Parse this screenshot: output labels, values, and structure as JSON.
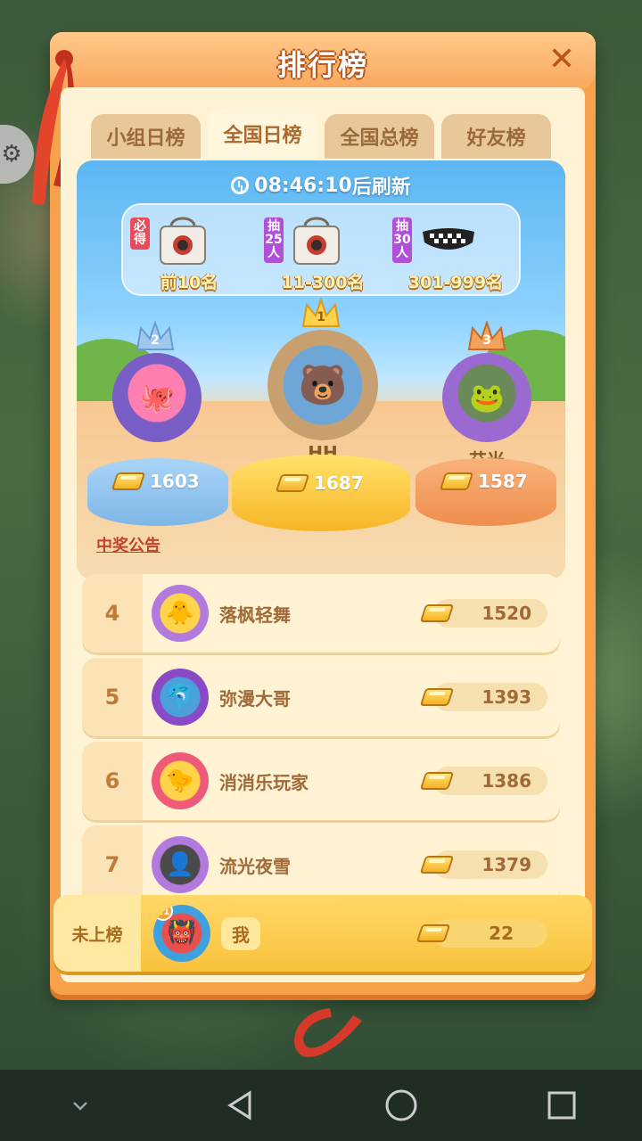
{
  "title": "排行榜",
  "close_label": "✕",
  "tabs": [
    {
      "label": "小组日榜",
      "active": false
    },
    {
      "label": "全国日榜",
      "active": true
    },
    {
      "label": "全国总榜",
      "active": false
    },
    {
      "label": "好友榜",
      "active": false
    }
  ],
  "refresh": {
    "time": "08:46:10",
    "suffix": "后刷新"
  },
  "rewards": [
    {
      "tag": "必得",
      "label": "前10名",
      "item": "tote-bag-icon"
    },
    {
      "tag": "抽25人",
      "label": "11-300名",
      "item": "tote-bag-icon"
    },
    {
      "tag": "抽30人",
      "label": "301-999名",
      "item": "belt-bag-icon"
    }
  ],
  "podium": {
    "first": {
      "rank": "1",
      "name": "HH",
      "score": "1687"
    },
    "second": {
      "rank": "2",
      "name": "。",
      "score": "1603"
    },
    "third": {
      "rank": "3",
      "name": "艾米",
      "score": "1587"
    }
  },
  "notice": "中奖公告",
  "rows": [
    {
      "rank": "4",
      "name": "落枫轻舞",
      "score": "1520"
    },
    {
      "rank": "5",
      "name": "弥漫大哥",
      "score": "1393"
    },
    {
      "rank": "6",
      "name": "消消乐玩家",
      "score": "1386"
    },
    {
      "rank": "7",
      "name": "流光夜雪",
      "score": "1379"
    }
  ],
  "me": {
    "rank_text": "未上榜",
    "level": "11",
    "name": "我",
    "score": "22"
  },
  "colors": {
    "accent": "#f7a24b",
    "gold": "#f5b323",
    "panel_bg": "#fff3d6"
  }
}
